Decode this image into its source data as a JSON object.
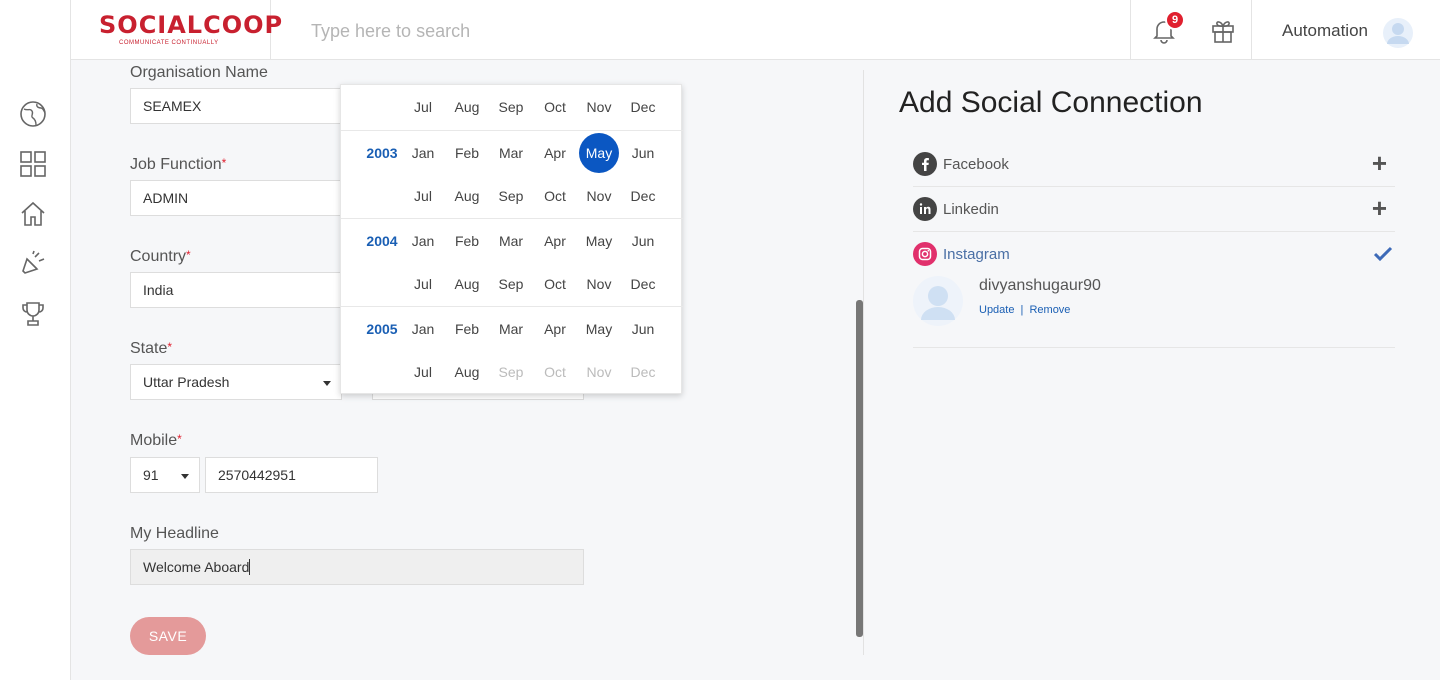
{
  "header": {
    "logo": "SOCIALCOOP",
    "logo_tagline": "COMMUNICATE CONTINUALLY",
    "search_placeholder": "Type here to search",
    "notification_count": "9",
    "username": "Automation"
  },
  "sidebar": {
    "icons": [
      "globe-icon",
      "grid-icon",
      "home-icon",
      "megaphone-icon",
      "trophy-icon"
    ]
  },
  "form": {
    "organisation_label": "Organisation Name",
    "organisation_value": "SEAMEX",
    "job_function_label": "Job Function",
    "job_function_value": "ADMIN",
    "country_label": "Country",
    "country_value": "India",
    "state_label": "State",
    "state_value": "Uttar Pradesh",
    "mobile_label": "Mobile",
    "mobile_code": "91",
    "mobile_number": "2570442951",
    "headline_label": "My Headline",
    "headline_value": "Welcome Aboard",
    "required_mark": "*",
    "save_label": "SAVE"
  },
  "picker": {
    "rows": [
      {
        "year": "",
        "months": [
          "Jul",
          "Aug",
          "Sep",
          "Oct",
          "Nov",
          "Dec"
        ]
      },
      {
        "year": "2003",
        "months": [
          "Jan",
          "Feb",
          "Mar",
          "Apr",
          "May",
          "Jun"
        ]
      },
      {
        "year": "",
        "months": [
          "Jul",
          "Aug",
          "Sep",
          "Oct",
          "Nov",
          "Dec"
        ]
      },
      {
        "year": "2004",
        "months": [
          "Jan",
          "Feb",
          "Mar",
          "Apr",
          "May",
          "Jun"
        ]
      },
      {
        "year": "",
        "months": [
          "Jul",
          "Aug",
          "Sep",
          "Oct",
          "Nov",
          "Dec"
        ]
      },
      {
        "year": "2005",
        "months": [
          "Jan",
          "Feb",
          "Mar",
          "Apr",
          "May",
          "Jun"
        ]
      },
      {
        "year": "",
        "months": [
          "Jul",
          "Aug",
          "Sep",
          "Oct",
          "Nov",
          "Dec"
        ]
      }
    ],
    "selected": {
      "year": "2003",
      "month": "May"
    },
    "disabled_from": {
      "year": "2005",
      "month": "Sep"
    }
  },
  "social": {
    "title": "Add Social Connection",
    "connections": [
      {
        "name": "Facebook",
        "icon": "facebook-icon",
        "status": "add"
      },
      {
        "name": "Linkedin",
        "icon": "linkedin-icon",
        "status": "add"
      },
      {
        "name": "Instagram",
        "icon": "instagram-icon",
        "status": "connected"
      }
    ],
    "account": {
      "handle": "divyanshugaur90",
      "update_label": "Update",
      "separator": "|",
      "remove_label": "Remove"
    }
  },
  "colors": {
    "brand": "#c8202f",
    "accent": "#0b57c2",
    "save_button": "#e49a9a",
    "instagram": "#e1306c"
  }
}
